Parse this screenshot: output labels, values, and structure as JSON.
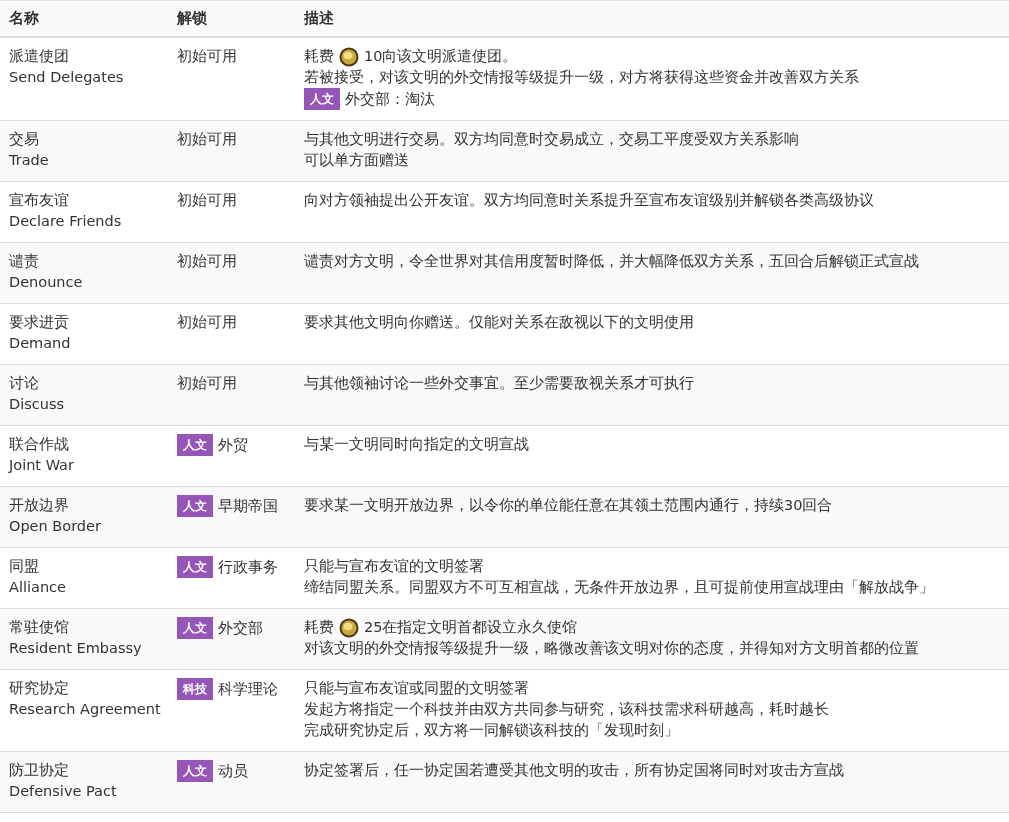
{
  "table": {
    "columns": [
      "名称",
      "解锁",
      "描述"
    ],
    "rows": [
      {
        "name": "派遣使团",
        "name_en": "Send Delegates",
        "unlock": {
          "text": "初始可用"
        },
        "desc": [
          {
            "kind": "cost",
            "prefix": "耗费",
            "text": "10向该文明派遣使团。"
          },
          {
            "kind": "text",
            "text": "若被接受，对该文明的外交情报等级提升一级，对方将获得这些资金并改善双方关系"
          },
          {
            "kind": "tag",
            "tag": "人文",
            "text": "外交部：淘汰"
          }
        ]
      },
      {
        "name": "交易",
        "name_en": "Trade",
        "unlock": {
          "text": "初始可用"
        },
        "desc": [
          {
            "kind": "text",
            "text": "与其他文明进行交易。双方均同意时交易成立，交易工平度受双方关系影响"
          },
          {
            "kind": "text",
            "text": "可以单方面赠送"
          }
        ]
      },
      {
        "name": "宣布友谊",
        "name_en": "Declare Friends",
        "unlock": {
          "text": "初始可用"
        },
        "desc": [
          {
            "kind": "text",
            "text": "向对方领袖提出公开友谊。双方均同意时关系提升至宣布友谊级别并解锁各类高级协议"
          }
        ]
      },
      {
        "name": "谴责",
        "name_en": "Denounce",
        "unlock": {
          "text": "初始可用"
        },
        "desc": [
          {
            "kind": "text",
            "text": "谴责对方文明，令全世界对其信用度暂时降低，并大幅降低双方关系，五回合后解锁正式宣战"
          }
        ]
      },
      {
        "name": "要求进贡",
        "name_en": "Demand",
        "unlock": {
          "text": "初始可用"
        },
        "desc": [
          {
            "kind": "text",
            "text": "要求其他文明向你赠送。仅能对关系在敌视以下的文明使用"
          }
        ]
      },
      {
        "name": "讨论",
        "name_en": "Discuss",
        "unlock": {
          "text": "初始可用"
        },
        "desc": [
          {
            "kind": "text",
            "text": "与其他领袖讨论一些外交事宜。至少需要敌视关系才可执行"
          }
        ]
      },
      {
        "name": "联合作战",
        "name_en": "Joint War",
        "unlock": {
          "tag": "人文",
          "text": "外贸"
        },
        "desc": [
          {
            "kind": "text",
            "text": "与某一文明同时向指定的文明宣战"
          }
        ]
      },
      {
        "name": "开放边界",
        "name_en": "Open Border",
        "unlock": {
          "tag": "人文",
          "text": "早期帝国"
        },
        "desc": [
          {
            "kind": "text",
            "text": "要求某一文明开放边界，以令你的单位能任意在其领土范围内通行，持续30回合"
          }
        ]
      },
      {
        "name": "同盟",
        "name_en": "Alliance",
        "unlock": {
          "tag": "人文",
          "text": "行政事务"
        },
        "desc": [
          {
            "kind": "text",
            "text": "只能与宣布友谊的文明签署"
          },
          {
            "kind": "text",
            "text": "缔结同盟关系。同盟双方不可互相宣战，无条件开放边界，且可提前使用宣战理由「解放战争」"
          }
        ]
      },
      {
        "name": "常驻使馆",
        "name_en": "Resident Embassy",
        "unlock": {
          "tag": "人文",
          "text": "外交部"
        },
        "desc": [
          {
            "kind": "cost",
            "prefix": "耗费",
            "text": "25在指定文明首都设立永久使馆"
          },
          {
            "kind": "text",
            "text": "对该文明的外交情报等级提升一级，略微改善该文明对你的态度，并得知对方文明首都的位置"
          }
        ]
      },
      {
        "name": "研究协定",
        "name_en": "Research Agreement",
        "unlock": {
          "tag": "科技",
          "text": "科学理论"
        },
        "desc": [
          {
            "kind": "text",
            "text": "只能与宣布友谊或同盟的文明签署"
          },
          {
            "kind": "text",
            "text": "发起方将指定一个科技并由双方共同参与研究，该科技需求科研越高，耗时越长"
          },
          {
            "kind": "text",
            "text": "完成研究协定后，双方将一同解锁该科技的「发现时刻」"
          }
        ]
      },
      {
        "name": "防卫协定",
        "name_en": "Defensive Pact",
        "unlock": {
          "tag": "人文",
          "text": "动员"
        },
        "desc": [
          {
            "kind": "text",
            "text": "协定签署后，任一协定国若遭受其他文明的攻击，所有协定国将同时对攻击方宣战"
          }
        ]
      }
    ]
  }
}
